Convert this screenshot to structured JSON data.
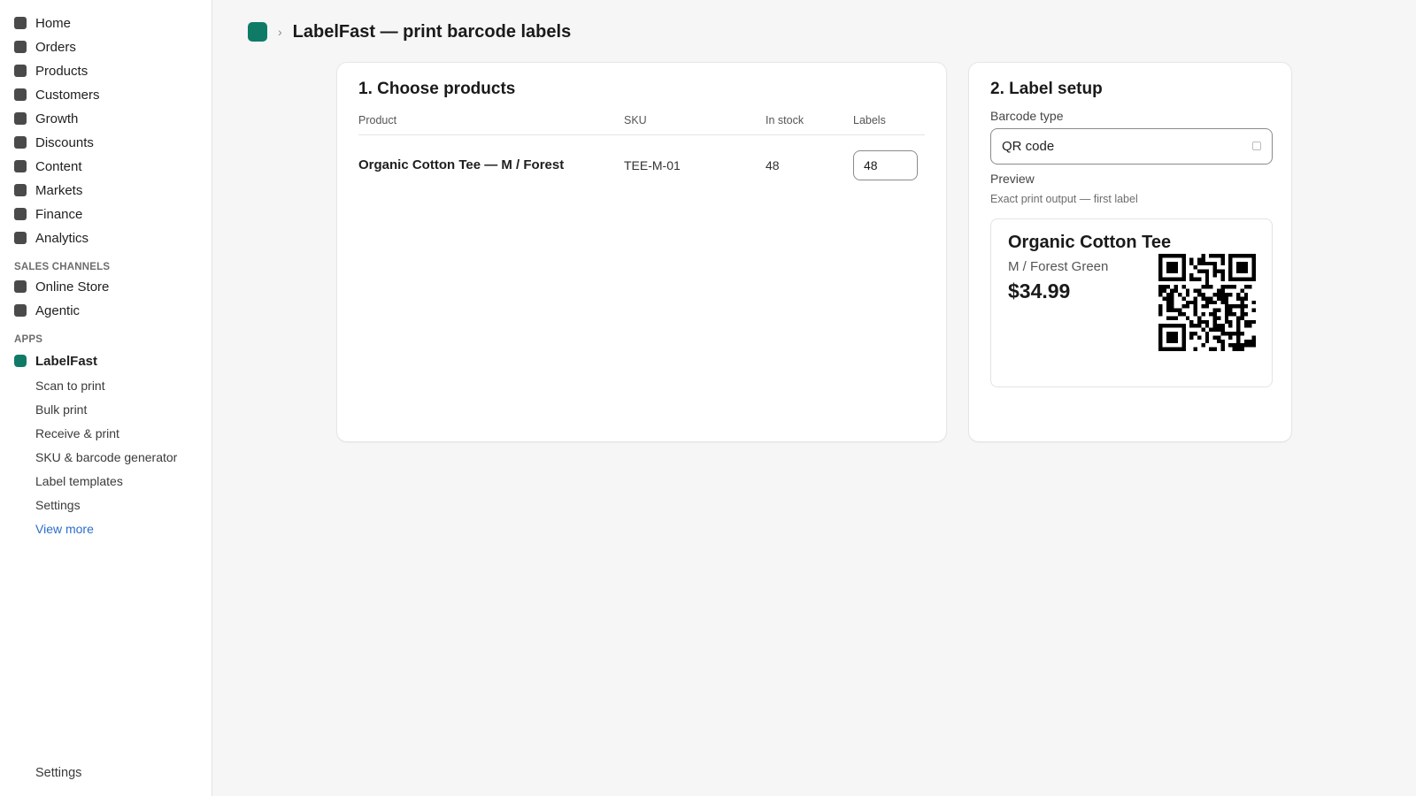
{
  "sidebar": {
    "main_items": [
      "Home",
      "Orders",
      "Products",
      "Customers",
      "Growth",
      "Discounts",
      "Content",
      "Markets",
      "Finance",
      "Analytics"
    ],
    "sales_channels_title": "SALES CHANNELS",
    "sales_channels": [
      "Online Store",
      "Agentic"
    ],
    "apps_title": "APPS",
    "app_name": "LabelFast",
    "app_subitems": [
      "Scan to print",
      "Bulk print",
      "Receive & print",
      "SKU & barcode generator",
      "Label templates",
      "Settings"
    ],
    "view_more": "View more",
    "bottom_settings": "Settings"
  },
  "header": {
    "separator": "›",
    "title": "LabelFast — print barcode labels"
  },
  "products_card": {
    "title": "1. Choose products",
    "columns": [
      "Product",
      "SKU",
      "In stock",
      "Labels"
    ],
    "rows": [
      {
        "product": "Organic Cotton Tee — M / Forest",
        "sku": "TEE-M-01",
        "in_stock": "48",
        "labels": "48"
      }
    ]
  },
  "setup_card": {
    "title": "2. Label setup",
    "barcode_type_label": "Barcode type",
    "barcode_type_value": "QR code",
    "preview_label": "Preview",
    "preview_hint": "Exact print output — first label",
    "label": {
      "name": "Organic Cotton Tee",
      "variant": "M / Forest Green",
      "price": "$34.99"
    }
  },
  "colors": {
    "accent": "#0f7b67",
    "link": "#2c6ecb",
    "nav_icon": "#4a4a4a"
  },
  "icons": {
    "nav_item": "square-icon",
    "app": "labelfast-app-icon",
    "select": "select-caret-icon",
    "code": "qr-code-icon"
  }
}
